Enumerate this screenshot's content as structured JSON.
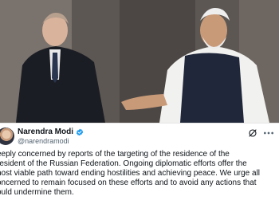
{
  "tweet": {
    "display_name": "Narendra Modi",
    "handle": "@narendramodi",
    "text": "eeply concerned by reports of the targeting of the residence of the\nresident of the Russian Federation. Ongoing diplomatic efforts offer the\nnost viable path toward ending hostilities and achieving peace. We urge all\noncerned to remain focused on these efforts and to avoid any actions that\nould undermine them."
  },
  "icons": {
    "verified": "verified-badge-icon",
    "grok": "grok-icon",
    "more": "more-options-icon"
  },
  "colors": {
    "verified_blue": "#1d9bf0",
    "text": "#0f1419",
    "secondary_text": "#536471"
  }
}
